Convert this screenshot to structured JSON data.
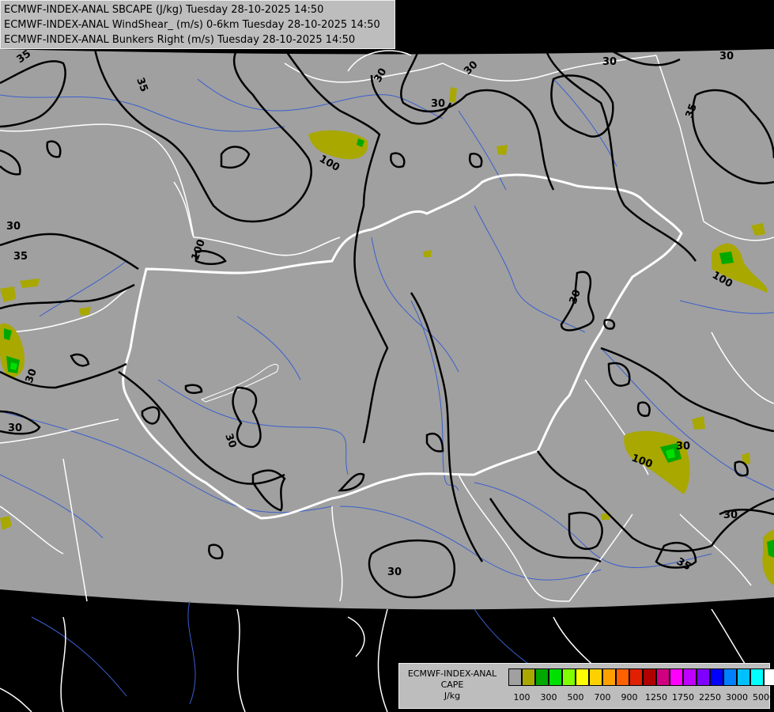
{
  "header": {
    "line1": "ECMWF-INDEX-ANAL SBCAPE (J/kg) Tuesday 28-10-2025 14:50",
    "line2": "ECMWF-INDEX-ANAL WindShear_ (m/s) 0-6km Tuesday 28-10-2025 14:50",
    "line3": "ECMWF-INDEX-ANAL Bunkers Right (m/s) Tuesday 28-10-2025 14:50"
  },
  "legend": {
    "title_line1": "ECMWF-INDEX-ANAL",
    "title_line2": "CAPE",
    "title_line3": "J/kg",
    "colors": [
      "#a0a0a0",
      "#a8a800",
      "#00a800",
      "#00e000",
      "#80ff00",
      "#ffff00",
      "#ffd000",
      "#ffa000",
      "#ff6000",
      "#e02000",
      "#b00000",
      "#d00080",
      "#ff00ff",
      "#c000ff",
      "#8000ff",
      "#0000ff",
      "#0080ff",
      "#00c0ff",
      "#00ffff",
      "#ffffff"
    ],
    "tick_labels": [
      "100",
      "300",
      "500",
      "700",
      "900",
      "1250",
      "1750",
      "2250",
      "3000",
      "5000"
    ]
  },
  "contour_labels": [
    "35",
    "30",
    "30",
    "35",
    "30",
    "35",
    "100",
    "30",
    "35",
    "30",
    "100",
    "30",
    "30",
    "30",
    "30",
    "100",
    "30",
    "100",
    "30",
    "30",
    "35",
    "30",
    "30",
    "35"
  ],
  "colors": {
    "domain_fill": "#a0a0a0",
    "outside": "#000000",
    "border": "#ffffff",
    "river": "#3a5fcd",
    "contour": "#000000",
    "cape_low": "#a8a800",
    "cape_mid": "#00a800",
    "cape_high": "#00e000"
  }
}
